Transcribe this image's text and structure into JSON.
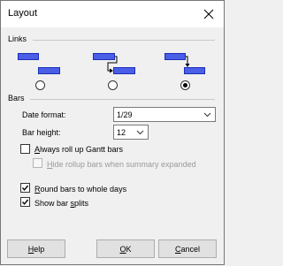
{
  "window": {
    "title": "Layout"
  },
  "links": {
    "group_label": "Links",
    "options": [
      {
        "id": "no-lines",
        "selected": false
      },
      {
        "id": "connected-lines",
        "selected": false
      },
      {
        "id": "drop-lines",
        "selected": true
      }
    ]
  },
  "bars": {
    "group_label": "Bars",
    "date_format": {
      "label": "Date format:",
      "value": "1/29"
    },
    "bar_height": {
      "label": "Bar height:",
      "value": "12"
    },
    "checks": {
      "rollup_gantt": {
        "prefix": "",
        "access": "A",
        "rest": "lways roll up Gantt bars",
        "checked": false
      },
      "hide_rollup": {
        "prefix": "",
        "access": "H",
        "rest": "ide rollup bars when summary expanded",
        "checked": false,
        "disabled": true
      },
      "round_bars": {
        "prefix": "",
        "access": "R",
        "rest": "ound bars to whole days",
        "checked": true
      },
      "show_splits": {
        "prefix": "Show bar ",
        "access": "s",
        "rest": "plits",
        "checked": true
      }
    }
  },
  "buttons": {
    "help": {
      "prefix": "",
      "access": "H",
      "rest": "elp"
    },
    "ok": {
      "prefix": "",
      "access": "O",
      "rest": "K"
    },
    "cancel": {
      "prefix": "",
      "access": "C",
      "rest": "ancel"
    }
  },
  "colors": {
    "bar_fill": "#4a5ee6",
    "bar_border": "#1a2fb8",
    "link_line": "#000000"
  }
}
